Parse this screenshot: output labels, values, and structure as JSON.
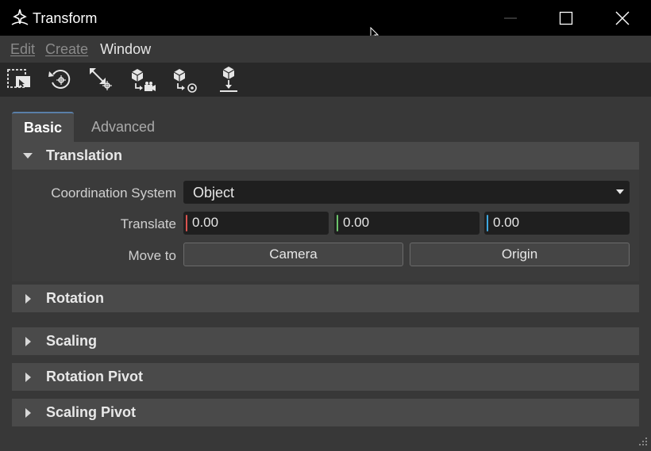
{
  "window": {
    "title": "Transform"
  },
  "menu": {
    "items": [
      "Edit",
      "Create",
      "Window"
    ]
  },
  "toolbar": {
    "tools": [
      "select-object-tool-icon",
      "reset-rotation-icon",
      "scale-to-fit-icon",
      "move-object-to-camera-icon",
      "move-object-to-origin-icon",
      "drop-to-ground-icon"
    ]
  },
  "tabs": {
    "active": "Basic",
    "inactive": "Advanced"
  },
  "translation": {
    "header": "Translation",
    "coord_label": "Coordination System",
    "coord_value": "Object",
    "translate_label": "Translate",
    "x": "0.00",
    "y": "0.00",
    "z": "0.00",
    "move_to_label": "Move to",
    "camera_button": "Camera",
    "origin_button": "Origin"
  },
  "sections": {
    "rotation": "Rotation",
    "scaling": "Scaling",
    "rotation_pivot": "Rotation Pivot",
    "scaling_pivot": "Scaling Pivot"
  },
  "colors": {
    "x_axis": "#d9534f",
    "y_axis": "#6cc36c",
    "z_axis": "#3ea8e0",
    "accent": "#5a7fa8"
  }
}
